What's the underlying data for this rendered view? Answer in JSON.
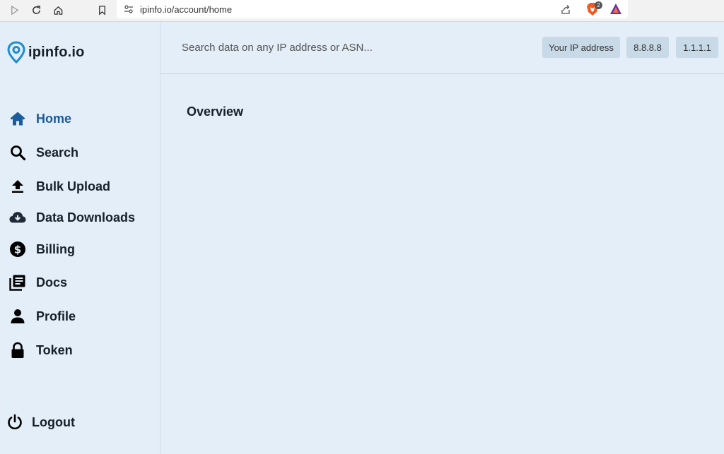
{
  "browser": {
    "url": "ipinfo.io/account/home",
    "icons": [
      "play-icon",
      "reload-icon",
      "home-icon",
      "bookmark-icon",
      "site-settings-icon",
      "share-icon",
      "brave-shields-icon",
      "brave-rewards-icon"
    ],
    "shields_count": "2"
  },
  "sidebar": {
    "logo_text": "ipinfo.io",
    "items": [
      {
        "label": "Home",
        "icon": "home-icon",
        "active": true
      },
      {
        "label": "Search",
        "icon": "search-icon"
      },
      {
        "label": "Bulk Upload",
        "icon": "upload-icon"
      },
      {
        "label": "Data Downloads",
        "icon": "cloud-download-icon"
      },
      {
        "label": "Billing",
        "icon": "dollar-icon"
      },
      {
        "label": "Docs",
        "icon": "docs-icon"
      },
      {
        "label": "Profile",
        "icon": "person-icon"
      },
      {
        "label": "Token",
        "icon": "lock-icon"
      }
    ],
    "logout_label": "Logout"
  },
  "search": {
    "placeholder": "Search data on any IP address or ASN...",
    "chips": [
      "Your IP address",
      "8.8.8.8",
      "1.1.1.1"
    ]
  },
  "main": {
    "title": "Overview"
  },
  "colors": {
    "background": "#e4eef8",
    "active": "#1a5c9c",
    "text": "#16202a",
    "chip": "#c8d9e8"
  }
}
